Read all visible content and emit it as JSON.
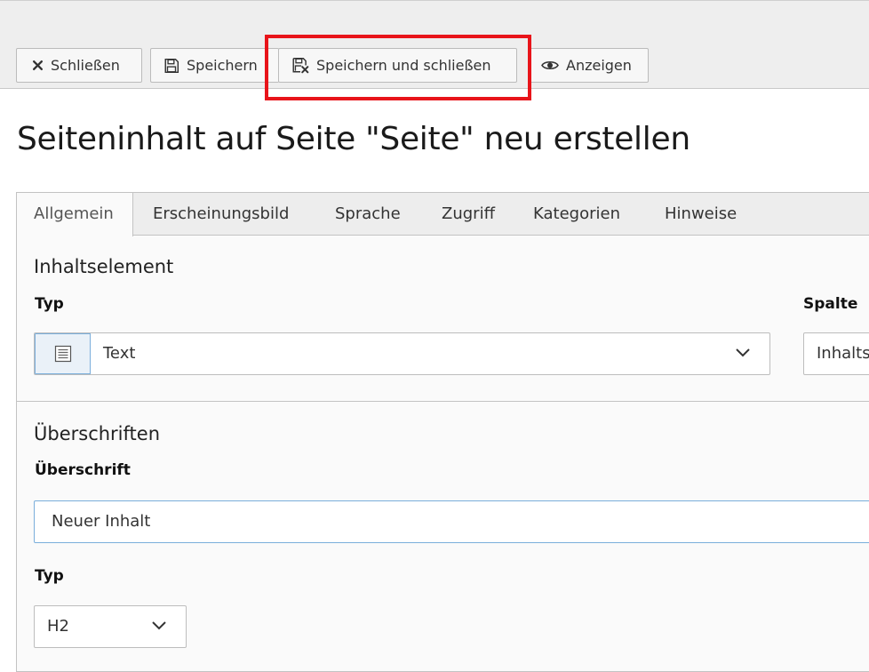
{
  "toolbar": {
    "close_label": "Schließen",
    "save_label": "Speichern",
    "save_close_label": "Speichern und schließen",
    "view_label": "Anzeigen"
  },
  "page": {
    "title": "Seiteninhalt auf Seite \"Seite\" neu erstellen"
  },
  "tabs": [
    {
      "label": "Allgemein",
      "active": true
    },
    {
      "label": "Erscheinungsbild",
      "active": false
    },
    {
      "label": "Sprache",
      "active": false
    },
    {
      "label": "Zugriff",
      "active": false
    },
    {
      "label": "Kategorien",
      "active": false
    },
    {
      "label": "Hinweise",
      "active": false
    }
  ],
  "content_element": {
    "section_title": "Inhaltselement",
    "type_label": "Typ",
    "type_value": "Text",
    "type_icon": "text-content-icon",
    "column_label": "Spalte",
    "column_value": "Inhalts"
  },
  "headings": {
    "section_title": "Überschriften",
    "heading_label": "Überschrift",
    "heading_value": "Neuer Inhalt",
    "type_label": "Typ",
    "type_value": "H2"
  },
  "colors": {
    "highlight": "#e8141a",
    "input_focus_border": "#7aaedb"
  }
}
